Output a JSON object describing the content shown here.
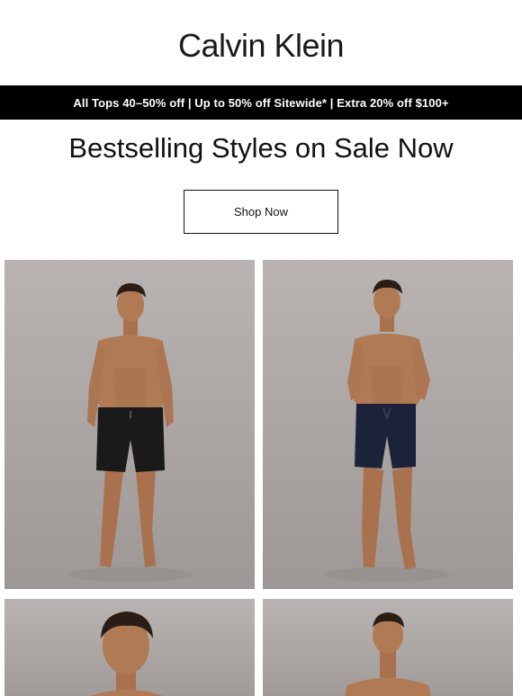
{
  "brand": {
    "logo_text": "Calvin Klein"
  },
  "promo": {
    "text": "All Tops 40–50% off | Up to 50% off Sitewide* | Extra 20% off $100+"
  },
  "hero": {
    "headline": "Bestselling Styles on Sale Now",
    "cta_label": "Shop Now"
  },
  "products": [
    {
      "image": "model-black-swim-shorts",
      "short_color": "#1a1a1a"
    },
    {
      "image": "model-navy-swim-shorts",
      "short_color": "#1c2338"
    },
    {
      "image": "model-portrait-1"
    },
    {
      "image": "model-portrait-2"
    }
  ],
  "colors": {
    "promo_bg": "#000000",
    "promo_text": "#ffffff",
    "tile_bg": "#aaa4a2",
    "skin": "#b07a55"
  }
}
